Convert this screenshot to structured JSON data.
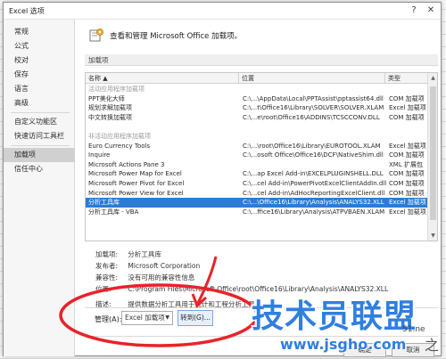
{
  "window": {
    "title": "Excel 选项",
    "help_glyph": "?",
    "close_glyph": "✕"
  },
  "sidebar": {
    "items": [
      {
        "label": "常规"
      },
      {
        "label": "公式"
      },
      {
        "label": "校对"
      },
      {
        "label": "保存"
      },
      {
        "label": "语言"
      },
      {
        "label": "高级"
      },
      {
        "label": "自定义功能区"
      },
      {
        "label": "快速访问工具栏"
      },
      {
        "label": "加载项"
      },
      {
        "label": "信任中心"
      }
    ],
    "active_index": 8
  },
  "header": {
    "text": "查看和管理 Microsoft Office 加载项。"
  },
  "addins": {
    "section_label": "加载项",
    "columns": [
      "名称 ▲",
      "位置",
      "类型"
    ],
    "rows": [
      {
        "group": true,
        "name": "活动应用程序加载项"
      },
      {
        "name": "PPT美化大师",
        "location": "C:\\...\\AppData\\Local\\PPTAssist\\pptassist64.dll",
        "type": "COM 加载项"
      },
      {
        "name": "规划求解加载项",
        "location": "C:\\...t\\Office16\\Library\\SOLVER\\SOLVER.XLAM",
        "type": "Excel 加载项"
      },
      {
        "name": "中文转换加载项",
        "location": "C:\\...e\\root\\Office16\\ADDINS\\TCSCCONV.DLL",
        "type": "COM 加载项"
      },
      {
        "group": true,
        "name": ""
      },
      {
        "group": true,
        "name": "非活动应用程序加载项"
      },
      {
        "name": "Euro Currency Tools",
        "location": "C:\\...\\root\\Office16\\Library\\EUROTOOL.XLAM",
        "type": "Excel 加载项"
      },
      {
        "name": "Inquire",
        "location": "C:\\...osoft Office\\Office16\\DCF\\NativeShim.dll",
        "type": "COM 加载项"
      },
      {
        "name": "Microsoft Actions Pane 3",
        "location": "",
        "type": "XML 扩展包"
      },
      {
        "name": "Microsoft Power Map for Excel",
        "location": "C:\\...ap Excel Add-in\\EXCELPLUGINSHELL.DLL",
        "type": "COM 加载项"
      },
      {
        "name": "Microsoft Power Pivot for Excel",
        "location": "C:\\...cel Add-in\\PowerPivotExcelClientAddIn.dll",
        "type": "COM 加载项"
      },
      {
        "name": "Microsoft Power View for Excel",
        "location": "C:\\...cel Add-in\\AdHocReportingExcelClient.dll",
        "type": "COM 加载项"
      },
      {
        "name": "分析工具库",
        "location": "C:\\...\\Office16\\Library\\Analysis\\ANALYS32.XLL",
        "type": "Excel 加载项",
        "selected": true
      },
      {
        "name": "分析工具库 - VBA",
        "location": "C:\\...ffice16\\Library\\Analysis\\ATPVBAEN.XLAM",
        "type": "Excel 加载项"
      }
    ]
  },
  "details": {
    "addin_label": "加载项:",
    "addin_value": "分析工具库",
    "publisher_label": "发布者:",
    "publisher_value": "Microsoft Corporation",
    "compat_label": "兼容性:",
    "compat_value": "没有可用的兼容性信息",
    "location_label": "位置:",
    "location_value": "C:\\Program Files\\Microsoft Office\\root\\Office16\\Library\\Analysis\\ANALYS32.XLL",
    "desc_label": "描述:",
    "desc_value": "提供数据分析工具用于统计和工程分析工具"
  },
  "manage": {
    "label": "管理(A):",
    "selected": "Excel 加载项",
    "goto_label": "转到(G)..."
  },
  "footer": {
    "ok_label": "确定",
    "cancel_label": "取消"
  },
  "watermark": {
    "brand": "技术员联盟",
    "url": "www.jsgho.com",
    "small": "51.ne",
    "home": "之家"
  },
  "colors": {
    "selection": "#2b7cd3",
    "annotation": "#e8232a",
    "watermark": "#2f7fe0"
  }
}
